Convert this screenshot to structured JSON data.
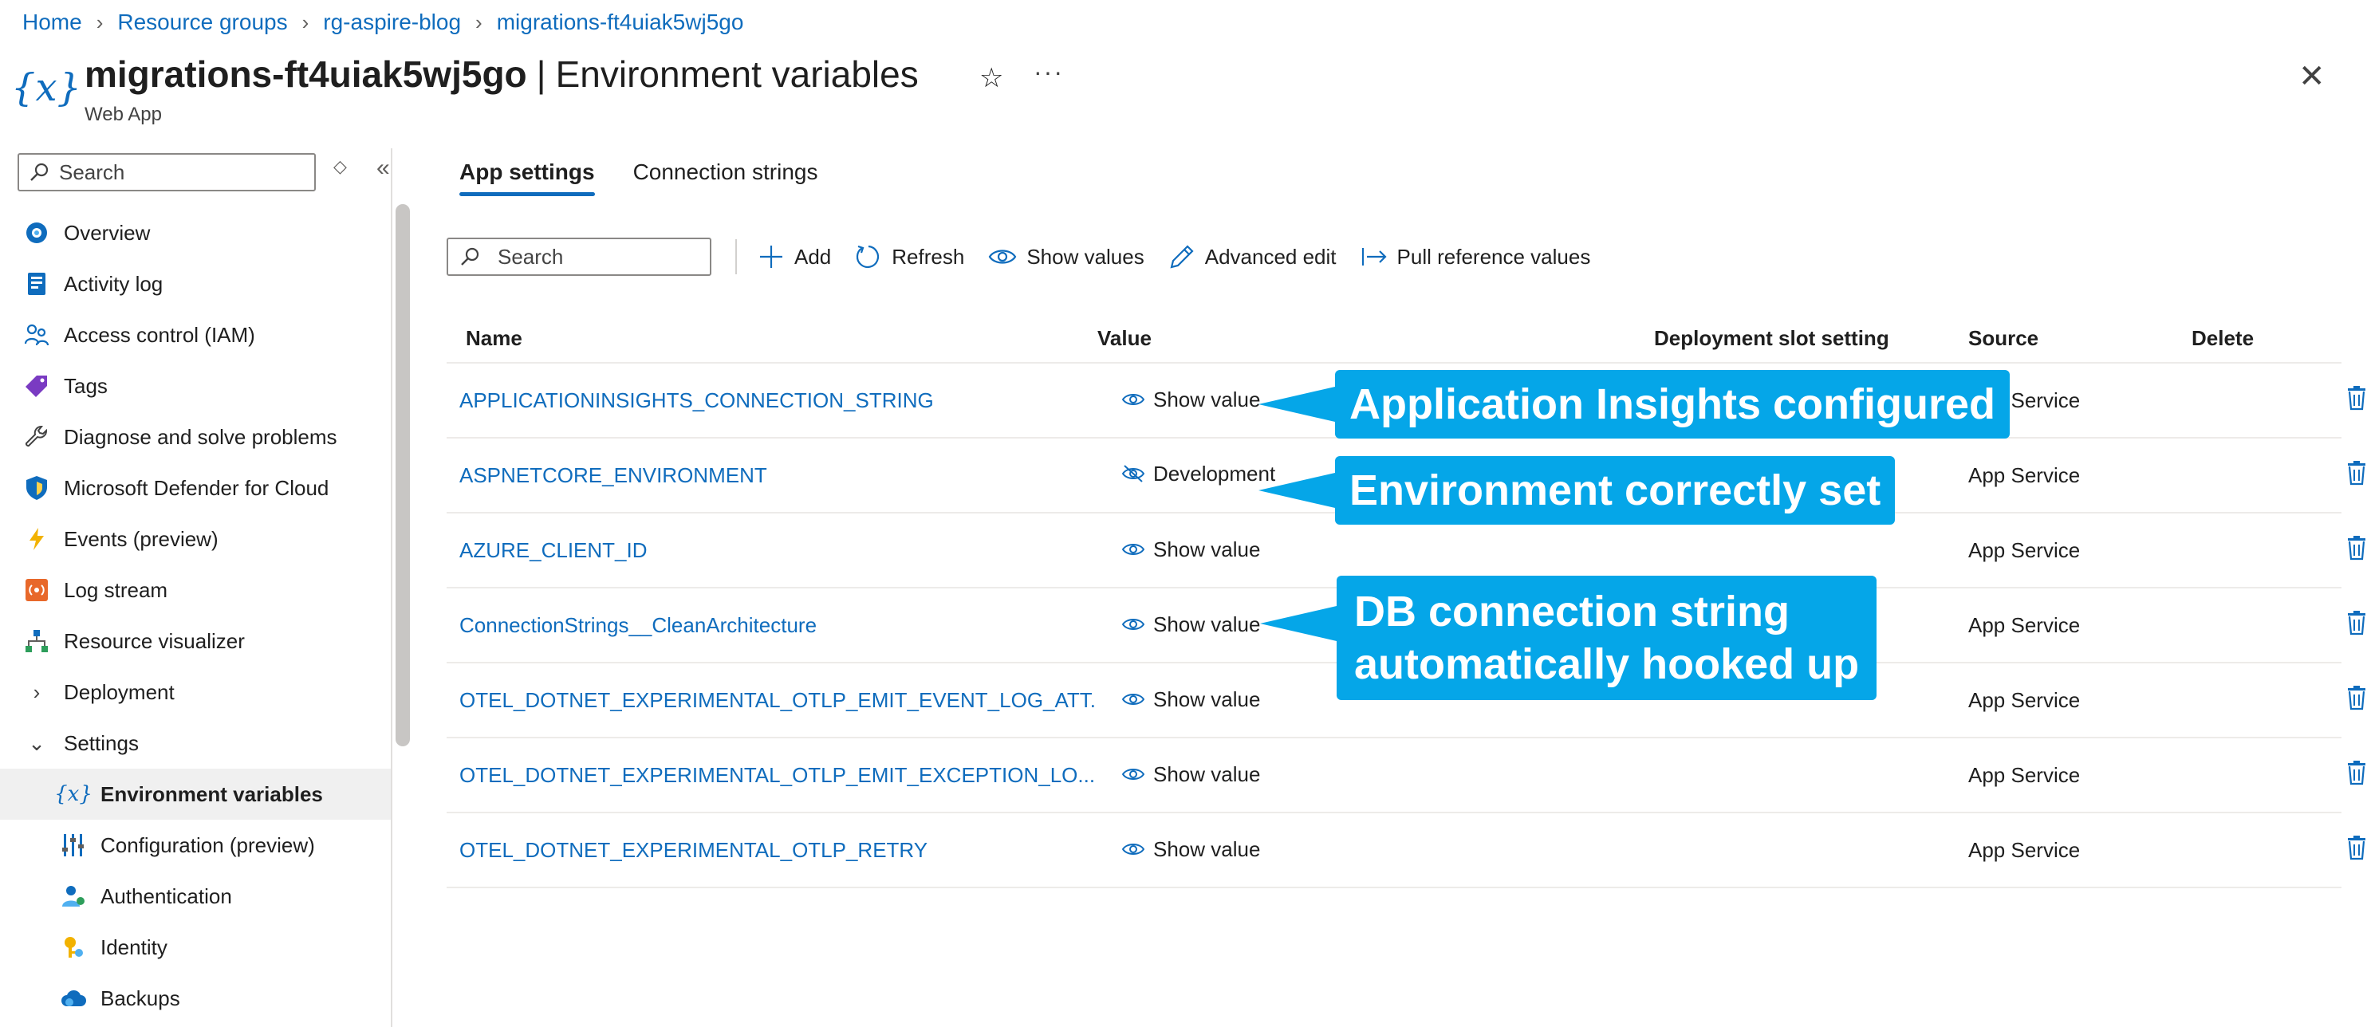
{
  "breadcrumb": [
    {
      "label": "Home"
    },
    {
      "label": "Resource groups"
    },
    {
      "label": "rg-aspire-blog"
    },
    {
      "label": "migrations-ft4uiak5wj5go"
    }
  ],
  "header": {
    "resource_name": "migrations-ft4uiak5wj5go",
    "separator": "|",
    "page_title": "Environment variables",
    "subtitle": "Web App",
    "icon": "environment-variables-icon",
    "star_icon": "star-icon",
    "more_icon": "more-options-icon",
    "close_icon": "close-icon"
  },
  "sidebar": {
    "search_placeholder": "Search",
    "items": [
      {
        "label": "Overview",
        "icon": "overview-icon"
      },
      {
        "label": "Activity log",
        "icon": "activity-log-icon"
      },
      {
        "label": "Access control (IAM)",
        "icon": "people-icon"
      },
      {
        "label": "Tags",
        "icon": "tag-icon"
      },
      {
        "label": "Diagnose and solve problems",
        "icon": "wrench-icon"
      },
      {
        "label": "Microsoft Defender for Cloud",
        "icon": "shield-icon"
      },
      {
        "label": "Events (preview)",
        "icon": "lightning-icon"
      },
      {
        "label": "Log stream",
        "icon": "log-stream-icon"
      },
      {
        "label": "Resource visualizer",
        "icon": "hierarchy-icon"
      },
      {
        "label": "Deployment",
        "icon": "chevron-right-icon"
      },
      {
        "label": "Settings",
        "icon": "chevron-down-icon"
      },
      {
        "label": "Environment variables",
        "icon": "environment-variables-icon",
        "active": true
      },
      {
        "label": "Configuration (preview)",
        "icon": "configuration-icon"
      },
      {
        "label": "Authentication",
        "icon": "authentication-icon"
      },
      {
        "label": "Identity",
        "icon": "identity-icon"
      },
      {
        "label": "Backups",
        "icon": "backup-cloud-icon"
      }
    ]
  },
  "tabs": [
    {
      "label": "App settings",
      "active": true
    },
    {
      "label": "Connection strings",
      "active": false
    }
  ],
  "toolbar": {
    "search_placeholder": "Search",
    "add": "Add",
    "refresh": "Refresh",
    "show_values": "Show values",
    "advanced_edit": "Advanced edit",
    "pull_reference_values": "Pull reference values"
  },
  "grid": {
    "columns": [
      "Name",
      "Value",
      "Deployment slot setting",
      "Source",
      "Delete"
    ],
    "rows": [
      {
        "name": "APPLICATIONINSIGHTS_CONNECTION_STRING",
        "value": "Show value",
        "hidden": true,
        "source": "App Service"
      },
      {
        "name": "ASPNETCORE_ENVIRONMENT",
        "value": "Development",
        "hidden": false,
        "source": "App Service"
      },
      {
        "name": "AZURE_CLIENT_ID",
        "value": "Show value",
        "hidden": true,
        "source": "App Service"
      },
      {
        "name": "ConnectionStrings__CleanArchitecture",
        "value": "Show value",
        "hidden": true,
        "source": "App Service"
      },
      {
        "name": "OTEL_DOTNET_EXPERIMENTAL_OTLP_EMIT_EVENT_LOG_ATT...",
        "value": "Show value",
        "hidden": true,
        "source": "App Service"
      },
      {
        "name": "OTEL_DOTNET_EXPERIMENTAL_OTLP_EMIT_EXCEPTION_LO...",
        "value": "Show value",
        "hidden": true,
        "source": "App Service"
      },
      {
        "name": "OTEL_DOTNET_EXPERIMENTAL_OTLP_RETRY",
        "value": "Show value",
        "hidden": true,
        "source": "App Service"
      }
    ]
  },
  "callouts": [
    {
      "text": "Application Insights configured"
    },
    {
      "text": "Environment correctly set"
    },
    {
      "line1": "DB connection string",
      "line2": "automatically hooked up"
    }
  ],
  "colors": {
    "accent": "#0f6cbd",
    "callout": "#05a6e8",
    "active_nav_bg": "#f0f0f0"
  }
}
